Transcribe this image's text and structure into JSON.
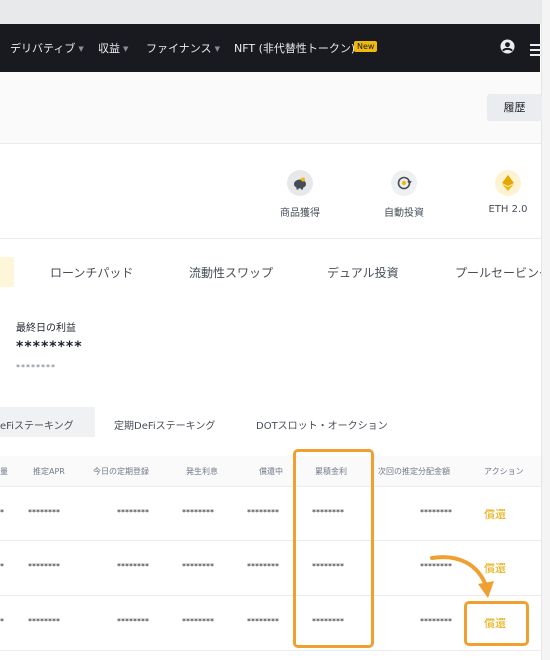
{
  "nav": {
    "items": [
      "デリバティブ",
      "収益",
      "ファイナンス"
    ],
    "nft_label": "NFT (非代替性トークン)",
    "new_badge": "New"
  },
  "header": {
    "history_button": "履歴"
  },
  "quick_links": [
    {
      "label": "商品獲得",
      "icon": "piggy-bank-icon"
    },
    {
      "label": "自動投資",
      "icon": "auto-invest-icon"
    },
    {
      "label": "ETH 2.0",
      "icon": "ethereum-icon"
    }
  ],
  "product_tabs": [
    "ローンチパッド",
    "流動性スワップ",
    "デュアル投資",
    "プールセービング"
  ],
  "earnings": {
    "label": "最終日の利益",
    "value": "********",
    "sub_value": "********"
  },
  "staking_tabs": [
    "eFiステーキング",
    "定期DeFiステーキング",
    "DOTスロット・オークション"
  ],
  "table": {
    "headers": [
      "推定APR",
      "今日の定期登録",
      "発生利息",
      "償還中",
      "累積金利",
      "次回の推定分配金額",
      "アクション"
    ],
    "rows": [
      {
        "cells": [
          "*",
          "********",
          "********",
          "********",
          "********",
          "********",
          "********"
        ],
        "action": "償還"
      },
      {
        "cells": [
          "*",
          "********",
          "********",
          "********",
          "********",
          "********",
          "********"
        ],
        "action": "償還"
      },
      {
        "cells": [
          "*",
          "********",
          "********",
          "********",
          "********",
          "********",
          "********"
        ],
        "action": "償還"
      }
    ]
  },
  "colors": {
    "nav_bg": "#181a20",
    "accent": "#f0b90b",
    "action_text": "#e6a800",
    "highlight": "#f0a030"
  }
}
